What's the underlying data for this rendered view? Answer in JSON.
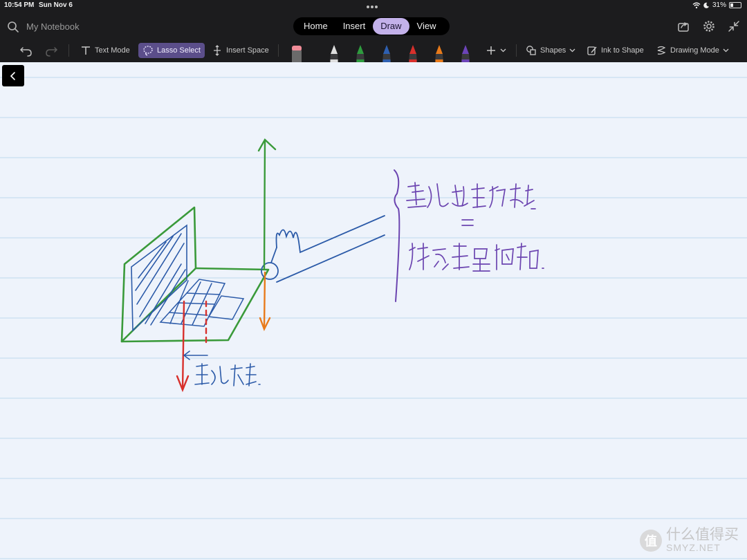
{
  "status": {
    "time": "10:54 PM",
    "date": "Sun Nov 6",
    "battery_percent": "31%",
    "battery_level": 0.31,
    "wifi_icon": "wifi-icon",
    "moon_icon": "moon-icon"
  },
  "header": {
    "notebook_title": "My Notebook",
    "tabs": [
      {
        "label": "Home",
        "active": false
      },
      {
        "label": "Insert",
        "active": false
      },
      {
        "label": "Draw",
        "active": true
      },
      {
        "label": "View",
        "active": false
      }
    ],
    "right_icons": [
      "share-icon",
      "gear-icon",
      "collapse-icon"
    ]
  },
  "toolbar": {
    "undo_icon": "undo-icon",
    "redo_icon": "redo-icon",
    "text_mode": "Text Mode",
    "lasso_select": "Lasso Select",
    "insert_space": "Insert Space",
    "shapes": "Shapes",
    "ink_to_shape": "Ink to Shape",
    "drawing_mode": "Drawing Mode",
    "pens": [
      {
        "name": "highlighter-pen",
        "color": "#dedede"
      },
      {
        "name": "green-pen",
        "color": "#2e9c3e"
      },
      {
        "name": "blue-pen",
        "color": "#2e5fb0"
      },
      {
        "name": "red-pen",
        "color": "#d8302c"
      },
      {
        "name": "orange-pen",
        "color": "#e87a1a"
      },
      {
        "name": "purple-pen",
        "color": "#6c44b8"
      }
    ],
    "eraser_color": "#f08c98"
  },
  "canvas": {
    "background": "#eef3fb",
    "rule_color": "#bfd9ee"
  },
  "watermark": {
    "badge": "值",
    "line1": "什么值得买",
    "line2": "SMYZ.NET"
  }
}
